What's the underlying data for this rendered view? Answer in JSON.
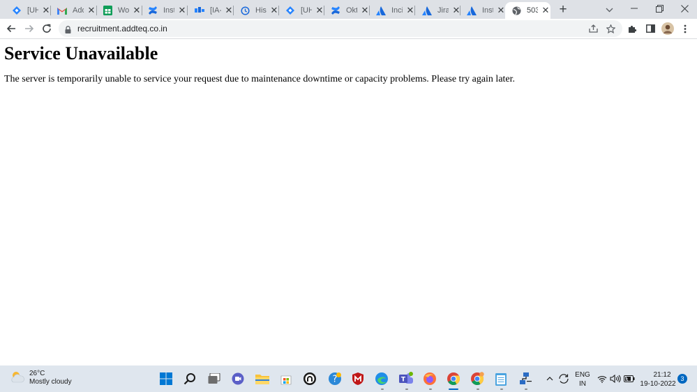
{
  "browser": {
    "tabs": [
      {
        "title": "[UH",
        "icon": "jira-diamond-icon"
      },
      {
        "title": "Add",
        "icon": "gmail-icon"
      },
      {
        "title": "Wo",
        "icon": "sheets-icon"
      },
      {
        "title": "Inst",
        "icon": "confluence-icon"
      },
      {
        "title": "[IA-",
        "icon": "jira-board-icon"
      },
      {
        "title": "Hist",
        "icon": "history-icon"
      },
      {
        "title": "[UH",
        "icon": "jira-diamond-icon"
      },
      {
        "title": "Okt",
        "icon": "confluence-icon"
      },
      {
        "title": "Inci",
        "icon": "atlassian-icon"
      },
      {
        "title": "Jira",
        "icon": "atlassian-icon"
      },
      {
        "title": "Inst",
        "icon": "atlassian-icon"
      },
      {
        "title": "503",
        "icon": "globe-icon",
        "active": true
      }
    ],
    "new_tab_label": "+",
    "url": "recruitment.addteq.co.in"
  },
  "page": {
    "heading": "Service Unavailable",
    "message": "The server is temporarily unable to service your request due to maintenance downtime or capacity problems. Please try again later."
  },
  "taskbar": {
    "weather": {
      "temp": "26°C",
      "condition": "Mostly cloudy"
    },
    "language": {
      "line1": "ENG",
      "line2": "IN"
    },
    "clock": {
      "time": "21:12",
      "date": "19-10-2022"
    },
    "notification_count": "3"
  },
  "colors": {
    "tabstrip_bg": "#dee1e6",
    "omnibox_bg": "#f1f3f4",
    "taskbar_bg": "#dfe6ee",
    "accent": "#0067c0"
  }
}
